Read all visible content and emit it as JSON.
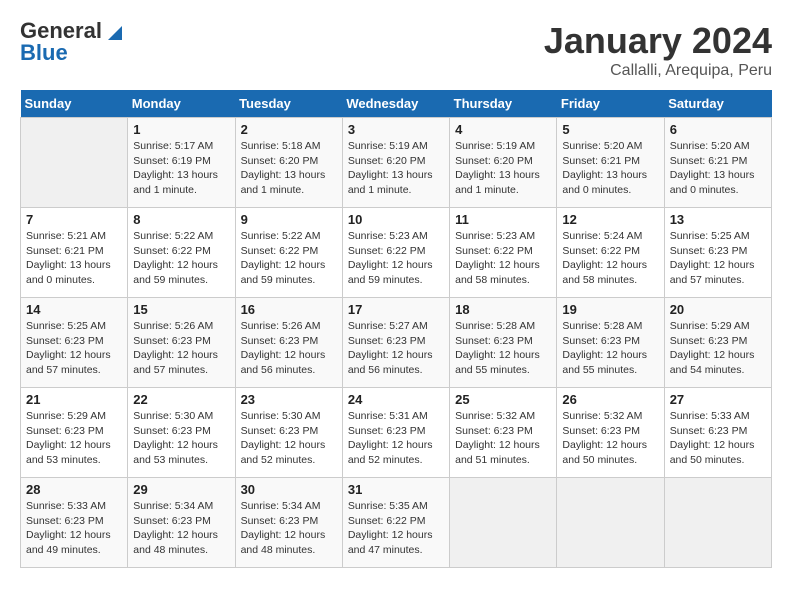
{
  "logo": {
    "general": "General",
    "blue": "Blue"
  },
  "title": "January 2024",
  "subtitle": "Callalli, Arequipa, Peru",
  "weekdays": [
    "Sunday",
    "Monday",
    "Tuesday",
    "Wednesday",
    "Thursday",
    "Friday",
    "Saturday"
  ],
  "weeks": [
    [
      {
        "day": "",
        "info": ""
      },
      {
        "day": "1",
        "info": "Sunrise: 5:17 AM\nSunset: 6:19 PM\nDaylight: 13 hours\nand 1 minute."
      },
      {
        "day": "2",
        "info": "Sunrise: 5:18 AM\nSunset: 6:20 PM\nDaylight: 13 hours\nand 1 minute."
      },
      {
        "day": "3",
        "info": "Sunrise: 5:19 AM\nSunset: 6:20 PM\nDaylight: 13 hours\nand 1 minute."
      },
      {
        "day": "4",
        "info": "Sunrise: 5:19 AM\nSunset: 6:20 PM\nDaylight: 13 hours\nand 1 minute."
      },
      {
        "day": "5",
        "info": "Sunrise: 5:20 AM\nSunset: 6:21 PM\nDaylight: 13 hours\nand 0 minutes."
      },
      {
        "day": "6",
        "info": "Sunrise: 5:20 AM\nSunset: 6:21 PM\nDaylight: 13 hours\nand 0 minutes."
      }
    ],
    [
      {
        "day": "7",
        "info": "Sunrise: 5:21 AM\nSunset: 6:21 PM\nDaylight: 13 hours\nand 0 minutes."
      },
      {
        "day": "8",
        "info": "Sunrise: 5:22 AM\nSunset: 6:22 PM\nDaylight: 12 hours\nand 59 minutes."
      },
      {
        "day": "9",
        "info": "Sunrise: 5:22 AM\nSunset: 6:22 PM\nDaylight: 12 hours\nand 59 minutes."
      },
      {
        "day": "10",
        "info": "Sunrise: 5:23 AM\nSunset: 6:22 PM\nDaylight: 12 hours\nand 59 minutes."
      },
      {
        "day": "11",
        "info": "Sunrise: 5:23 AM\nSunset: 6:22 PM\nDaylight: 12 hours\nand 58 minutes."
      },
      {
        "day": "12",
        "info": "Sunrise: 5:24 AM\nSunset: 6:22 PM\nDaylight: 12 hours\nand 58 minutes."
      },
      {
        "day": "13",
        "info": "Sunrise: 5:25 AM\nSunset: 6:23 PM\nDaylight: 12 hours\nand 57 minutes."
      }
    ],
    [
      {
        "day": "14",
        "info": "Sunrise: 5:25 AM\nSunset: 6:23 PM\nDaylight: 12 hours\nand 57 minutes."
      },
      {
        "day": "15",
        "info": "Sunrise: 5:26 AM\nSunset: 6:23 PM\nDaylight: 12 hours\nand 57 minutes."
      },
      {
        "day": "16",
        "info": "Sunrise: 5:26 AM\nSunset: 6:23 PM\nDaylight: 12 hours\nand 56 minutes."
      },
      {
        "day": "17",
        "info": "Sunrise: 5:27 AM\nSunset: 6:23 PM\nDaylight: 12 hours\nand 56 minutes."
      },
      {
        "day": "18",
        "info": "Sunrise: 5:28 AM\nSunset: 6:23 PM\nDaylight: 12 hours\nand 55 minutes."
      },
      {
        "day": "19",
        "info": "Sunrise: 5:28 AM\nSunset: 6:23 PM\nDaylight: 12 hours\nand 55 minutes."
      },
      {
        "day": "20",
        "info": "Sunrise: 5:29 AM\nSunset: 6:23 PM\nDaylight: 12 hours\nand 54 minutes."
      }
    ],
    [
      {
        "day": "21",
        "info": "Sunrise: 5:29 AM\nSunset: 6:23 PM\nDaylight: 12 hours\nand 53 minutes."
      },
      {
        "day": "22",
        "info": "Sunrise: 5:30 AM\nSunset: 6:23 PM\nDaylight: 12 hours\nand 53 minutes."
      },
      {
        "day": "23",
        "info": "Sunrise: 5:30 AM\nSunset: 6:23 PM\nDaylight: 12 hours\nand 52 minutes."
      },
      {
        "day": "24",
        "info": "Sunrise: 5:31 AM\nSunset: 6:23 PM\nDaylight: 12 hours\nand 52 minutes."
      },
      {
        "day": "25",
        "info": "Sunrise: 5:32 AM\nSunset: 6:23 PM\nDaylight: 12 hours\nand 51 minutes."
      },
      {
        "day": "26",
        "info": "Sunrise: 5:32 AM\nSunset: 6:23 PM\nDaylight: 12 hours\nand 50 minutes."
      },
      {
        "day": "27",
        "info": "Sunrise: 5:33 AM\nSunset: 6:23 PM\nDaylight: 12 hours\nand 50 minutes."
      }
    ],
    [
      {
        "day": "28",
        "info": "Sunrise: 5:33 AM\nSunset: 6:23 PM\nDaylight: 12 hours\nand 49 minutes."
      },
      {
        "day": "29",
        "info": "Sunrise: 5:34 AM\nSunset: 6:23 PM\nDaylight: 12 hours\nand 48 minutes."
      },
      {
        "day": "30",
        "info": "Sunrise: 5:34 AM\nSunset: 6:23 PM\nDaylight: 12 hours\nand 48 minutes."
      },
      {
        "day": "31",
        "info": "Sunrise: 5:35 AM\nSunset: 6:22 PM\nDaylight: 12 hours\nand 47 minutes."
      },
      {
        "day": "",
        "info": ""
      },
      {
        "day": "",
        "info": ""
      },
      {
        "day": "",
        "info": ""
      }
    ]
  ]
}
